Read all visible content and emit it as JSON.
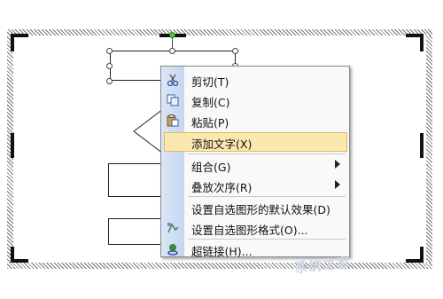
{
  "menu": {
    "items": [
      {
        "label": "剪切(T)",
        "icon": "scissors-icon"
      },
      {
        "label": "复制(C)",
        "icon": "copy-icon"
      },
      {
        "label": "粘贴(P)",
        "icon": "paste-icon"
      },
      {
        "label": "添加文字(X)",
        "highlighted": true
      },
      {
        "label": "组合(G)",
        "submenu": true
      },
      {
        "label": "叠放次序(R)",
        "submenu": true
      },
      {
        "label": "设置自选图形的默认效果(D)"
      },
      {
        "label": "设置自选图形格式(O)...",
        "icon": "format-shape-icon"
      },
      {
        "label": "超链接(H)...",
        "icon": "hyperlink-icon"
      }
    ]
  },
  "watermark": {
    "text": "系统之家"
  },
  "colors": {
    "highlight": "#fbe8b0",
    "gutter": "#c4d6f0",
    "rotate_handle": "#5cc04a"
  }
}
